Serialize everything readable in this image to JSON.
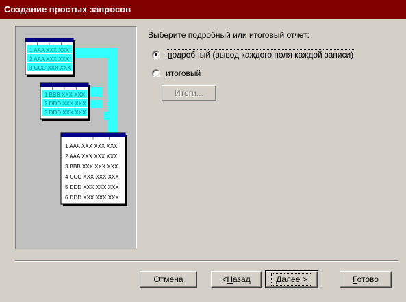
{
  "window": {
    "title": "Создание простых запросов"
  },
  "illustration": {
    "table1_rows": [
      {
        "num": "1",
        "val": "AAA",
        "rest": "XXX XXX"
      },
      {
        "num": "2",
        "val": "AAA",
        "rest": "XXX XXX"
      },
      {
        "num": "3",
        "val": "CCC",
        "rest": "XXX XXX"
      }
    ],
    "table2_rows": [
      {
        "num": "1",
        "val": "BBB",
        "rest": "XXX XXX"
      },
      {
        "num": "2",
        "val": "DDD",
        "rest": "XXX XXX"
      },
      {
        "num": "3",
        "val": "DDD",
        "rest": "XXX XXX"
      }
    ],
    "table3_rows": [
      {
        "num": "1",
        "val": "AAA",
        "rest": "XXX XXX XXX"
      },
      {
        "num": "2",
        "val": "AAA",
        "rest": "XXX XXX XXX"
      },
      {
        "num": "3",
        "val": "BBB",
        "rest": "XXX XXX XXX"
      },
      {
        "num": "4",
        "val": "CCC",
        "rest": "XXX XXX XXX"
      },
      {
        "num": "5",
        "val": "DDD",
        "rest": "XXX XXX XXX"
      },
      {
        "num": "6",
        "val": "DDD",
        "rest": "XXX XXX XXX"
      }
    ]
  },
  "main": {
    "prompt": "Выберите подробный или итоговый отчет:",
    "options": [
      {
        "label": "подробный (вывод каждого поля каждой записи)",
        "selected": true
      },
      {
        "label": "итоговый",
        "selected": false
      }
    ],
    "totals_button": "Итоги..."
  },
  "buttons": {
    "cancel": "Отмена",
    "back": "< Назад",
    "next": "Далее >",
    "finish": "Готово"
  }
}
